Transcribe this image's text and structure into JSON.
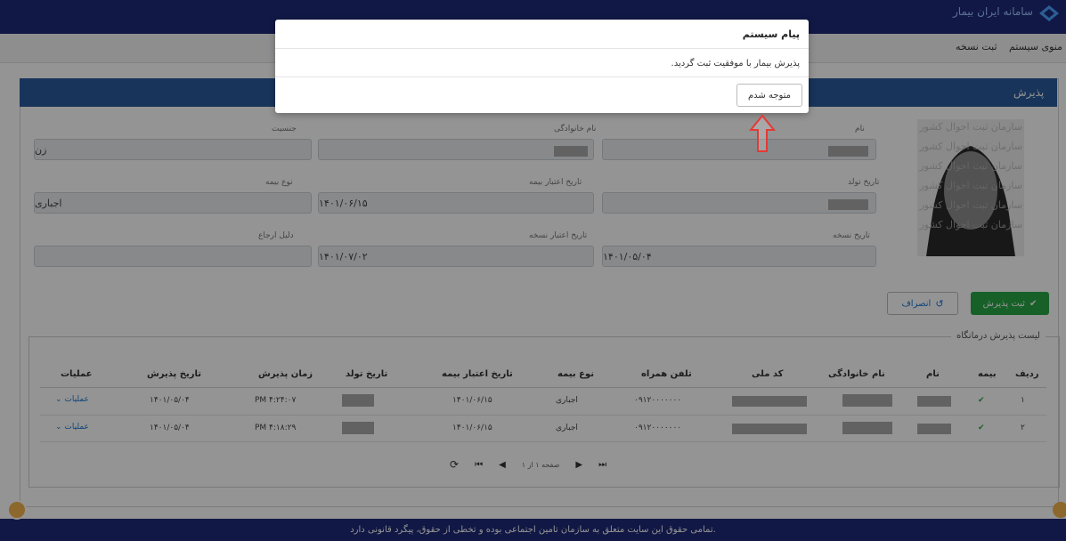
{
  "header": {
    "logo_text": "سامانه ایران بیمار",
    "menu": {
      "system_menu": "منوی سیستم",
      "prescription_register": "ثبت نسخه"
    }
  },
  "panel": {
    "title": "پذیرش"
  },
  "watermark_lines": [
    "سازمان ثبت احوال کشور",
    "سازمان ثبت احوال کشور",
    "سازمان ثبت احوال کشور",
    "سازمان ثبت احوال کشور",
    "سازمان ثبت احوال کشور",
    "سازمان ثبت احوال کشور"
  ],
  "form": {
    "first_name": {
      "label": "نام",
      "value": ""
    },
    "last_name": {
      "label": "نام خانوادگی",
      "value": ""
    },
    "gender": {
      "label": "جنسیت",
      "value": "زن"
    },
    "birth_date": {
      "label": "تاریخ تولد",
      "value": ""
    },
    "insurance_validity": {
      "label": "تاریخ اعتبار بیمه",
      "value": "۱۴۰۱/۰۶/۱۵"
    },
    "insurance_type": {
      "label": "نوع بیمه",
      "value": "اجباری"
    },
    "prescription_date": {
      "label": "تاریخ نسخه",
      "value": "۱۴۰۱/۰۵/۰۴"
    },
    "prescription_validity": {
      "label": "تاریخ اعتبار نسخه",
      "value": "۱۴۰۱/۰۷/۰۲"
    },
    "referral_reason": {
      "label": "دلیل ارجاع",
      "value": ""
    }
  },
  "buttons": {
    "submit": "ثبت پذیرش",
    "cancel": "انصراف"
  },
  "table": {
    "legend": "لیست پذیرش درمانگاه",
    "headers": [
      "ردیف",
      "بیمه",
      "نام",
      "نام خانوادگی",
      "کد ملی",
      "تلفن همراه",
      "نوع بیمه",
      "تاریخ اعتبار بیمه",
      "تاریخ تولد",
      "زمان پذیرش",
      "تاریخ پذیرش",
      "عملیات"
    ],
    "rows": [
      {
        "index": "۱",
        "insurance_check": "✔",
        "phone": "۰۹۱۲۰۰۰۰۰۰۰",
        "insurance_type": "اجباری",
        "insurance_validity": "۱۴۰۱/۰۶/۱۵",
        "time": "PM ۴:۲۴:۰۷",
        "date": "۱۴۰۱/۰۵/۰۴",
        "action": "عملیات"
      },
      {
        "index": "۲",
        "insurance_check": "✔",
        "phone": "۰۹۱۲۰۰۰۰۰۰۰",
        "insurance_type": "اجباری",
        "insurance_validity": "۱۴۰۱/۰۶/۱۵",
        "time": "PM ۴:۱۸:۲۹",
        "date": "۱۴۰۱/۰۵/۰۴",
        "action": "عملیات"
      }
    ],
    "pagination": {
      "label": "صفحه ۱ از ۱"
    }
  },
  "modal": {
    "title": "پیام سیستم",
    "message": "پذیرش بیمار با موفقیت ثبت گردید.",
    "ok_button": "متوجه شدم"
  },
  "footer": {
    "text": "تمامی حقوق این سایت متعلق به سازمان تامین اجتماعی بوده و تخطی از حقوق، پیگرد قانونی دارد."
  },
  "colors": {
    "brand_dark": "#1e2a78",
    "panel_header": "#2a5a9b",
    "success_button": "#28a745",
    "accent_red": "#e53935",
    "link_blue": "#1976d2"
  }
}
